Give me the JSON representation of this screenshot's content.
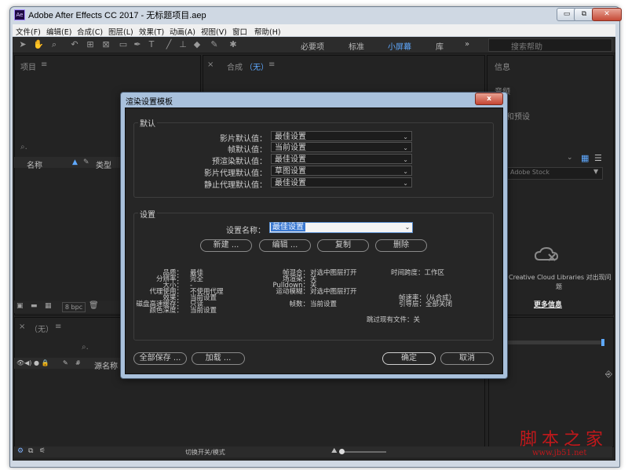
{
  "window": {
    "title": "Adobe After Effects CC 2017 - 无标题项目.aep",
    "icon": "Ae",
    "controls": [
      "▭",
      "⧉",
      "✕"
    ]
  },
  "menu": [
    "文件(F)",
    "编辑(E)",
    "合成(C)",
    "图层(L)",
    "效果(T)",
    "动画(A)",
    "视图(V)",
    "窗口",
    "帮助(H)"
  ],
  "workspaces": {
    "items": [
      "必要项",
      "标准",
      "小屏幕",
      "库"
    ],
    "active": "小屏幕",
    "more": "»",
    "search_placeholder": "搜索帮助"
  },
  "panels": {
    "project_title": "项目",
    "project_menu": "≡",
    "comp_close": "×",
    "comp_title": "合成",
    "comp_none": "（无）",
    "comp_menu": "≡",
    "info_title": "信息",
    "right_item1": "音频",
    "right_item2": "和预设",
    "col_name": "名称",
    "col_type": "类型",
    "bpc": "8 bpc",
    "adobe_stock": "Adobe Stock",
    "cc_text_1": "Creative Cloud Libraries 对出现问",
    "cc_text_2": "题",
    "more_info": "更多信息",
    "timeline_close": "×",
    "timeline_none": "（无）",
    "timeline_menu": "≡",
    "layer_col": "源名称",
    "toggle_modes": "切换开关/模式"
  },
  "dialog": {
    "title": "渲染设置模板",
    "close_label": "x",
    "defaults_title": "默认",
    "defaults": [
      {
        "label": "影片默认值：",
        "value": "最佳设置"
      },
      {
        "label": "帧默认值：",
        "value": "当前设置"
      },
      {
        "label": "预渲染默认值：",
        "value": "最佳设置"
      },
      {
        "label": "影片代理默认值：",
        "value": "草图设置"
      },
      {
        "label": "静止代理默认值：",
        "value": "最佳设置"
      }
    ],
    "settings_title": "设置",
    "setting_name_label": "设置名称：",
    "setting_name_value": "最佳设置",
    "buttons": {
      "new": "新建 ...",
      "edit": "编辑 ...",
      "duplicate": "复制",
      "delete": "删除",
      "save_all": "全部保存 ...",
      "load": "加载 ...",
      "ok": "确定",
      "cancel": "取消"
    },
    "summary_col1": [
      {
        "k": "品质：",
        "v": "最佳"
      },
      {
        "k": "分辨率：",
        "v": "完全"
      },
      {
        "k": "大小：",
        "v": "-"
      },
      {
        "k": "代理使用：",
        "v": "不使用代理"
      },
      {
        "k": "效果：",
        "v": "当前设置"
      },
      {
        "k": "磁盘高速缓存：",
        "v": "只读"
      },
      {
        "k": "颜色深度：",
        "v": "当前设置"
      }
    ],
    "summary_col2": [
      {
        "k": "帧混合：",
        "v": "对选中图层打开"
      },
      {
        "k": "场渲染：",
        "v": "关"
      },
      {
        "k": "Pulldown：",
        "v": "关"
      },
      {
        "k": "运动模糊：",
        "v": "对选中图层打开"
      },
      {
        "k": "",
        "v": ""
      },
      {
        "k": "帧数：",
        "v": "当前设置"
      }
    ],
    "summary_time_span": "时间跨度：工作区",
    "summary_fps": "帧速率：（从合成）",
    "summary_guide": "引导层：全部关闭",
    "summary_skip": "跳过现有文件：关"
  },
  "watermark": {
    "text": "脚本之家",
    "url": "www.jb51.net"
  }
}
